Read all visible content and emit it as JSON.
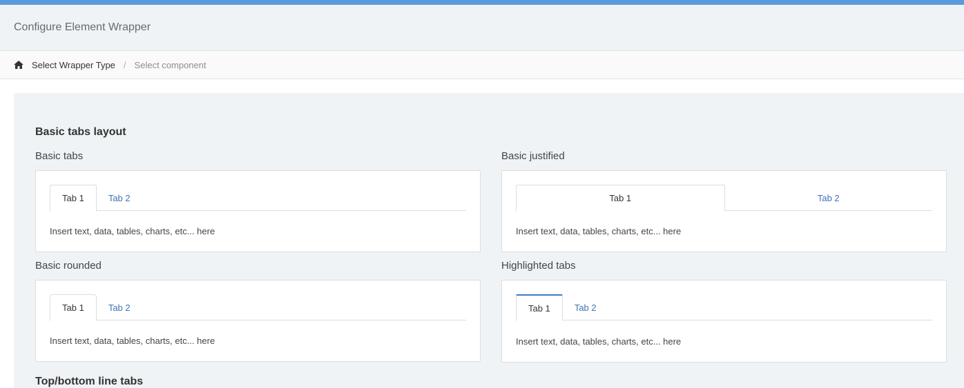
{
  "header": {
    "title": "Configure Element Wrapper"
  },
  "breadcrumb": {
    "home_icon": "home-icon",
    "active": "Select Wrapper Type",
    "separator": "/",
    "current": "Select component"
  },
  "colors": {
    "accent": "#5b9bdc",
    "link": "#3d72b4",
    "content_bg": "#eff3f6"
  },
  "section": {
    "title": "Basic tabs layout"
  },
  "panels": {
    "basic_tabs": {
      "label": "Basic tabs",
      "tab1": "Tab 1",
      "tab2": "Tab 2",
      "body": "Insert text, data, tables, charts, etc... here"
    },
    "basic_justified": {
      "label": "Basic justified",
      "tab1": "Tab 1",
      "tab2": "Tab 2",
      "body": "Insert text, data, tables, charts, etc... here"
    },
    "basic_rounded": {
      "label": "Basic rounded",
      "tab1": "Tab 1",
      "tab2": "Tab 2",
      "body": "Insert text, data, tables, charts, etc... here"
    },
    "highlighted_tabs": {
      "label": "Highlighted tabs",
      "tab1": "Tab 1",
      "tab2": "Tab 2",
      "body": "Insert text, data, tables, charts, etc... here"
    }
  },
  "next_section": {
    "title": "Top/bottom line tabs"
  }
}
